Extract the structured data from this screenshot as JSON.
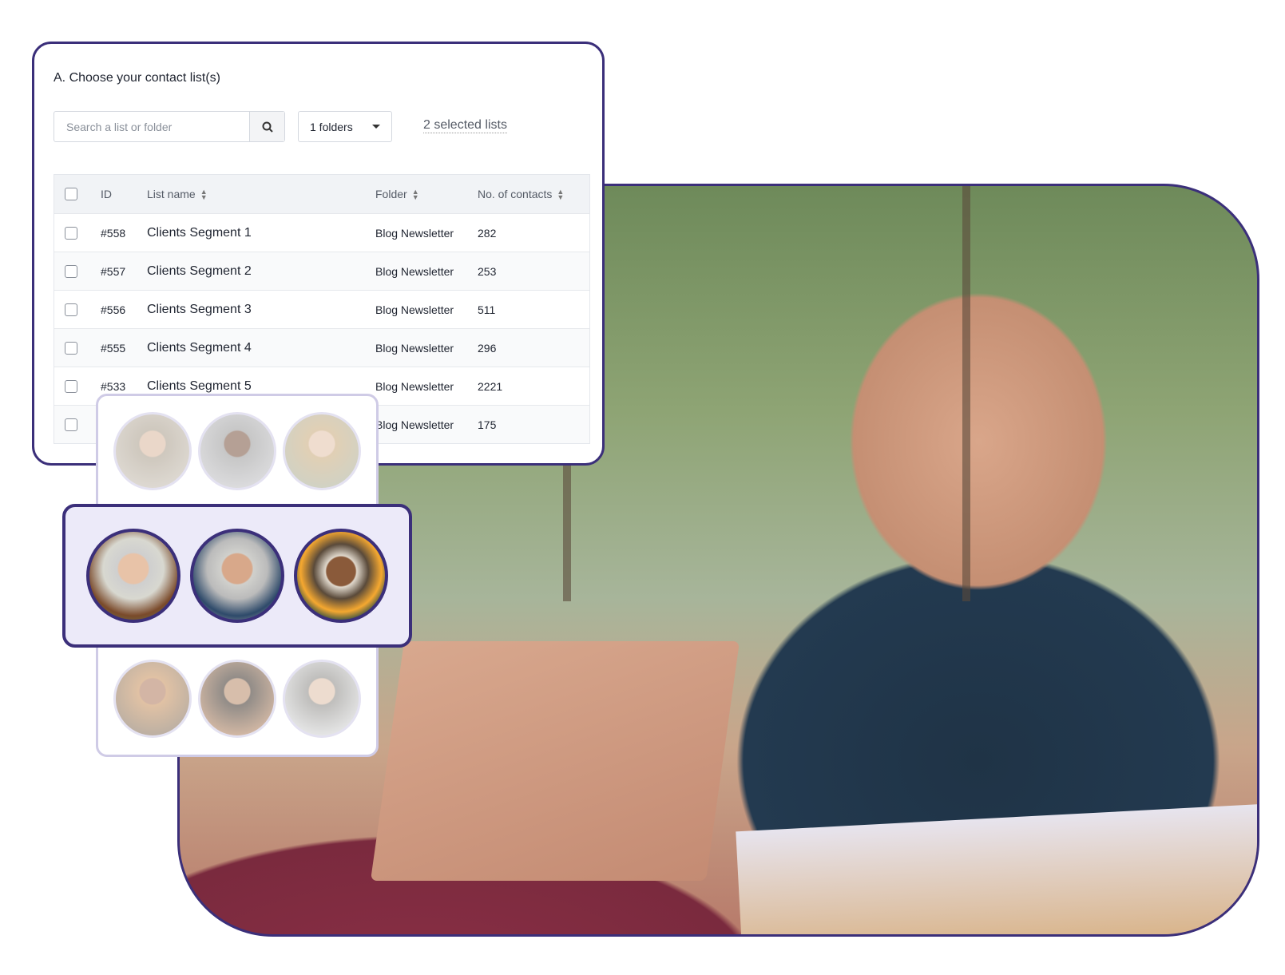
{
  "card": {
    "title": "A. Choose your contact list(s)",
    "search_placeholder": "Search a list or folder",
    "folders_label": "1 folders",
    "selected_label": "2 selected lists",
    "columns": [
      "ID",
      "List name",
      "Folder",
      "No. of contacts"
    ],
    "rows": [
      {
        "id": "#558",
        "name": "Clients Segment 1",
        "folder": "Blog Newsletter",
        "contacts": "282"
      },
      {
        "id": "#557",
        "name": "Clients Segment 2",
        "folder": "Blog Newsletter",
        "contacts": "253"
      },
      {
        "id": "#556",
        "name": "Clients Segment 3",
        "folder": "Blog Newsletter",
        "contacts": "511"
      },
      {
        "id": "#555",
        "name": "Clients Segment 4",
        "folder": "Blog Newsletter",
        "contacts": "296"
      },
      {
        "id": "#533",
        "name": "Clients Segment 5",
        "folder": "Blog Newsletter",
        "contacts": "2221"
      },
      {
        "id": "",
        "name": "",
        "folder": "Blog Newsletter",
        "contacts": "175"
      }
    ]
  },
  "colors": {
    "accent": "#3b2f7a",
    "highlight_bg": "#eceaf9"
  }
}
